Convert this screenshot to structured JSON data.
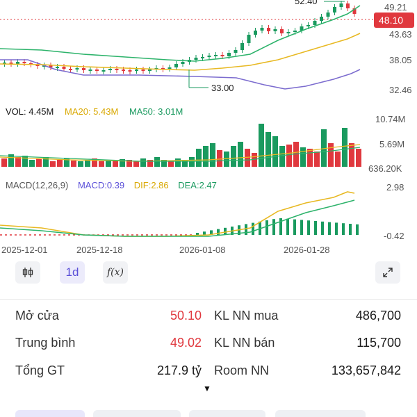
{
  "price_chart": {
    "current_price": "48.10",
    "y_axis_labels": [
      "49.21",
      "43.63",
      "38.05",
      "32.46"
    ],
    "annotations": {
      "high": "52.40",
      "low": "33.00"
    }
  },
  "volume_header": {
    "vol": "VOL: 4.45M",
    "ma20": "MA20: 5.43M",
    "ma50": "MA50: 3.01M"
  },
  "volume_axis_labels": [
    "10.74M",
    "5.69M",
    "636.20K"
  ],
  "macd_header": {
    "macd": "MACD(12,26,9)",
    "macd_value": "MACD:0.39",
    "dif": "DIF:2.86",
    "dea": "DEA:2.47"
  },
  "macd_axis_labels": [
    "2.98",
    "-0.42"
  ],
  "date_axis": [
    "2025-12-01",
    "2025-12-18",
    "2026-01-08",
    "2026-01-28"
  ],
  "toolbar": {
    "candle_icon": "candlestick-icon",
    "period_label": "1d",
    "formula_label": "f(x)",
    "expand_icon": "expand-icon"
  },
  "stats": {
    "open_label": "Mở cửa",
    "open_value": "50.10",
    "avg_label": "Trung bình",
    "avg_value": "49.02",
    "total_label": "Tổng GT",
    "total_value": "217.9 tỷ",
    "foreign_buy_label": "KL NN mua",
    "foreign_buy_value": "486,700",
    "foreign_sell_label": "KL NN bán",
    "foreign_sell_value": "115,700",
    "room_label": "Room NN",
    "room_value": "133,657,842"
  },
  "colors": {
    "up": "#1a9a5f",
    "down": "#e0383e",
    "ma_yellow": "#e8b923",
    "ma_green": "#2db36b",
    "ma_purple": "#7c6ccf",
    "accent": "#5a4fd8"
  }
}
